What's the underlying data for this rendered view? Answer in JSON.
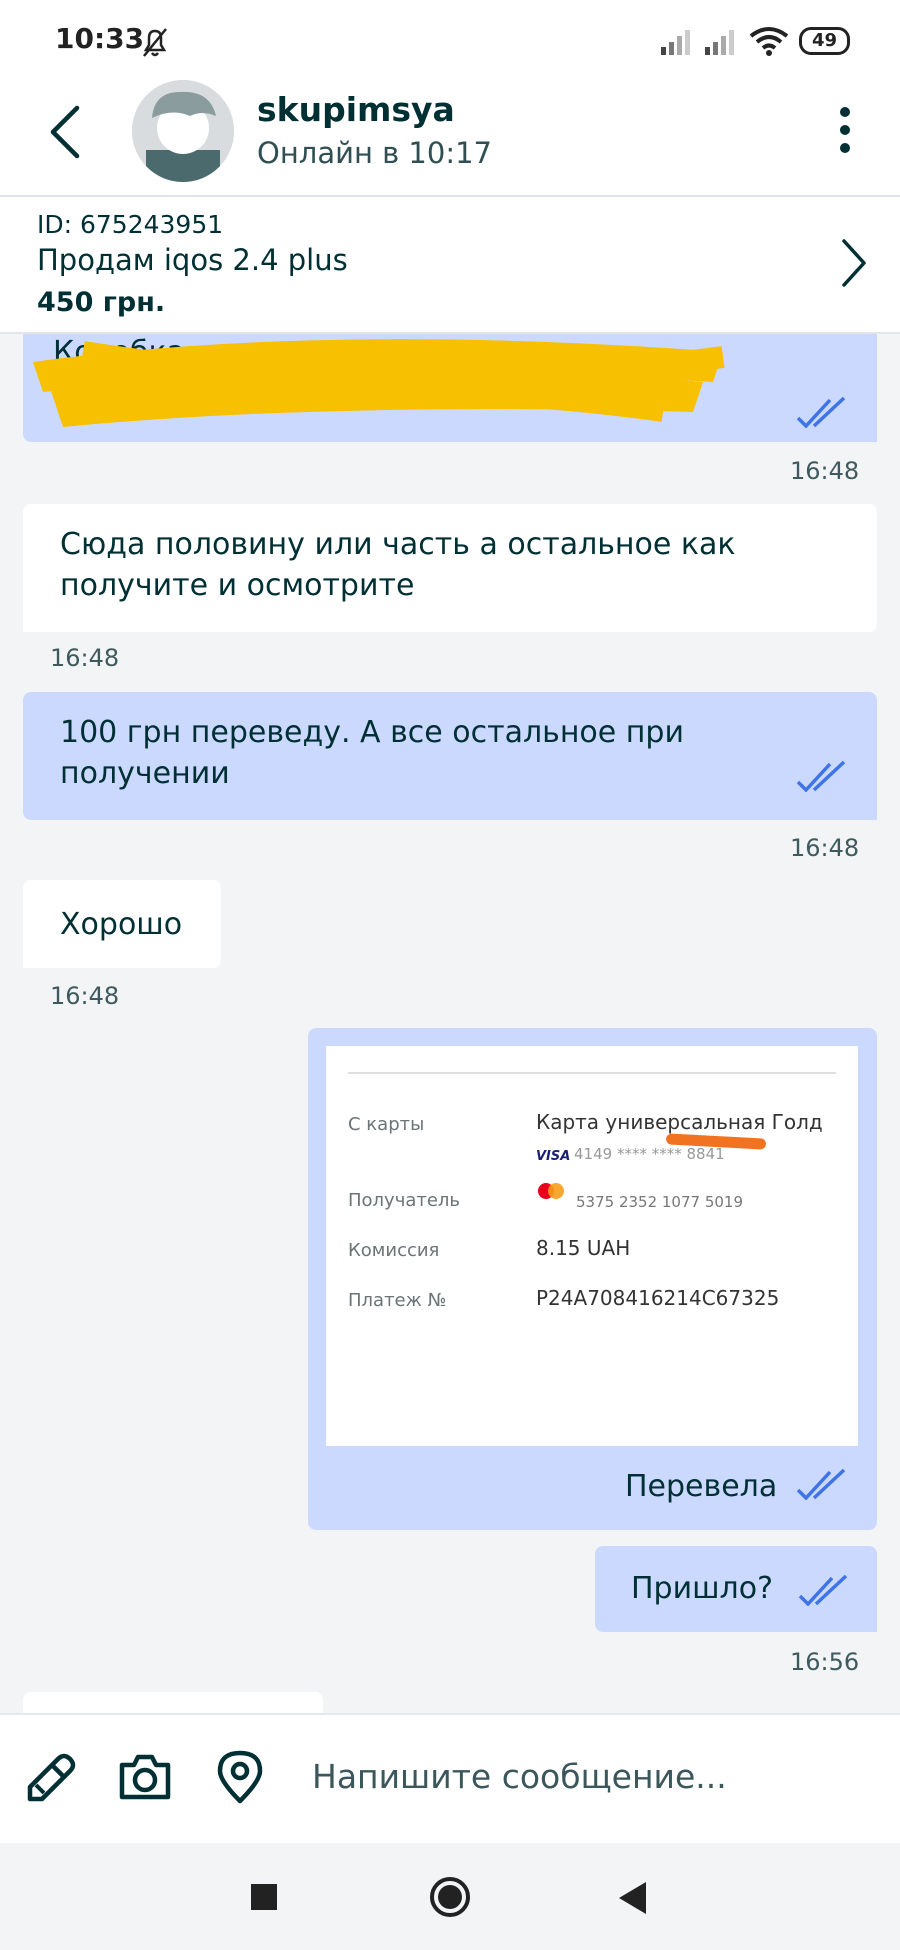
{
  "status_bar": {
    "time": "10:33",
    "battery": "49"
  },
  "header": {
    "username": "skupimsya",
    "status": "Онлайн в 10:17"
  },
  "ad": {
    "id": "ID: 675243951",
    "title": "Продам iqos 2.4 plus",
    "price": "450 грн."
  },
  "messages": [
    {
      "dir": "out",
      "text": "",
      "time": "16:48",
      "redacted": true
    },
    {
      "dir": "in",
      "text": "Сюда половину или часть а остальное как получите и осмотрите",
      "time": "16:48"
    },
    {
      "dir": "out",
      "text": "100 грн переведу. А все остальное при получении",
      "time": "16:48"
    },
    {
      "dir": "in",
      "text": "Хорошо",
      "time": "16:48"
    },
    {
      "dir": "out",
      "type": "image",
      "caption": "Перевела",
      "receipt": {
        "from_label": "С карты",
        "from_value": "Карта универсальная Голд",
        "from_card": "4149 **** **** 8841",
        "recipient_label": "Получатель",
        "recipient_card": "5375 2352 1077 5019",
        "fee_label": "Комиссия",
        "fee_value": "8.15 UAH",
        "payment_label": "Платеж №",
        "payment_value": "P24A708416214C67325"
      }
    },
    {
      "dir": "out",
      "text": "Пришло?",
      "time": "16:56"
    }
  ],
  "input": {
    "placeholder": "Напишите сообщение..."
  },
  "colors": {
    "outgoing_bubble": "#cbd9ff",
    "incoming_bubble": "#ffffff",
    "check": "#3f74e6",
    "redaction": "#f7c000",
    "redaction_card": "#f2731f"
  },
  "icons": [
    "back-arrow-icon",
    "more-icon",
    "chevron-right-icon",
    "double-check-icon",
    "paperclip-icon",
    "camera-icon",
    "location-icon",
    "square-nav-icon",
    "circle-nav-icon",
    "triangle-nav-icon"
  ]
}
